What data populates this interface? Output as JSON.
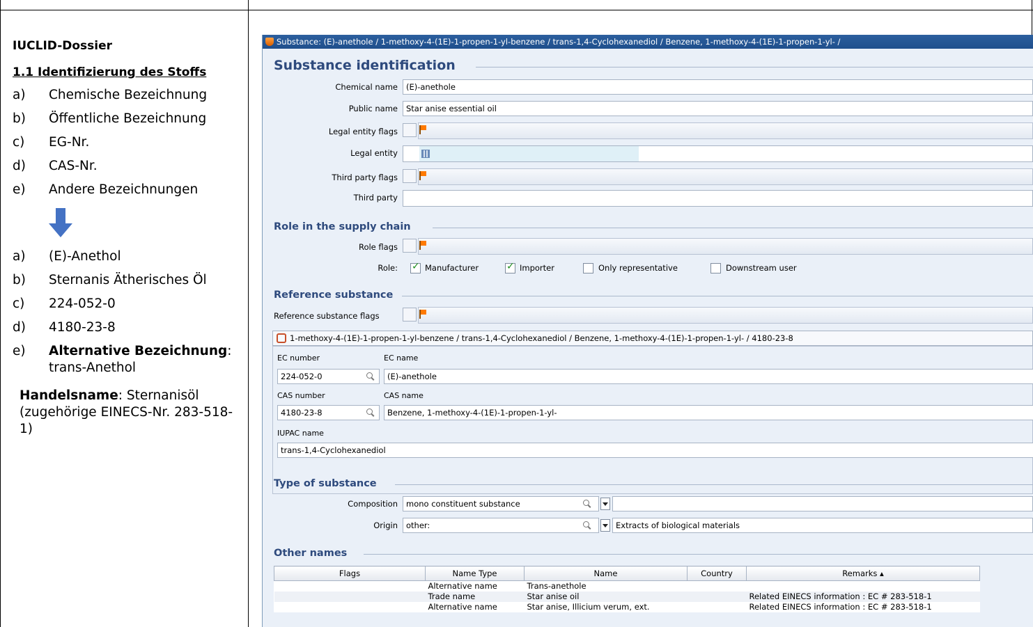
{
  "left_column": {
    "heading": "IUCLID-Dossier",
    "subheading": "1.1 Identifizierung des Stoffs",
    "criteria": [
      {
        "label": "a)",
        "text": "Chemische Bezeichnung"
      },
      {
        "label": "b)",
        "text": "Öffentliche Bezeichnung"
      },
      {
        "label": "c)",
        "text": "EG-Nr."
      },
      {
        "label": "d)",
        "text": "CAS-Nr."
      },
      {
        "label": "e)",
        "text": "Andere Bezeichnungen"
      }
    ],
    "answers": [
      {
        "label": "a)",
        "text": "(E)-Anethol"
      },
      {
        "label": "b)",
        "text": "Sternanis Ätherisches Öl"
      },
      {
        "label": "c)",
        "text": "224-052-0"
      },
      {
        "label": "d)",
        "text": "4180-23-8"
      }
    ],
    "answer_e": {
      "label": "e)",
      "bold": "Alternative Bezeichnung",
      "rest": ": trans-Anethol"
    },
    "trade": {
      "bold": "Handelsname",
      "rest": ": Sternanisöl (zugehörige EINECS-Nr. 283-518-1)"
    }
  },
  "app": {
    "window_title": "Substance: (E)-anethole / 1-methoxy-4-(1E)-1-propen-1-yl-benzene / trans-1,4-Cyclohexanediol / Benzene, 1-methoxy-4-(1E)-1-propen-1-yl- /",
    "substance_identification": {
      "title": "Substance identification",
      "chemical_name_label": "Chemical name",
      "chemical_name": "(E)-anethole",
      "public_name_label": "Public name",
      "public_name": "Star anise essential oil",
      "legal_entity_flags_label": "Legal entity flags",
      "legal_entity_label": "Legal entity",
      "third_party_flags_label": "Third party flags",
      "third_party_label": "Third party",
      "third_party": ""
    },
    "role": {
      "title": "Role in the supply chain",
      "role_flags_label": "Role flags",
      "role_label": "Role:",
      "options": [
        {
          "label": "Manufacturer",
          "checked": true
        },
        {
          "label": "Importer",
          "checked": true
        },
        {
          "label": "Only representative",
          "checked": false
        },
        {
          "label": "Downstream user",
          "checked": false
        }
      ]
    },
    "reference": {
      "title": "Reference substance",
      "flags_label": "Reference substance flags",
      "link_text": "1-methoxy-4-(1E)-1-propen-1-yl-benzene / trans-1,4-Cyclohexanediol / Benzene, 1-methoxy-4-(1E)-1-propen-1-yl- / 4180-23-8",
      "ec_number_label": "EC number",
      "ec_number": "224-052-0",
      "ec_name_label": "EC name",
      "ec_name": "(E)-anethole",
      "cas_number_label": "CAS number",
      "cas_number": "4180-23-8",
      "cas_name_label": "CAS name",
      "cas_name": "Benzene, 1-methoxy-4-(1E)-1-propen-1-yl-",
      "iupac_label": "IUPAC name",
      "iupac_name": "trans-1,4-Cyclohexanediol"
    },
    "type": {
      "title": "Type of substance",
      "composition_label": "Composition",
      "composition": "mono constituent substance",
      "composition_extra": "",
      "origin_label": "Origin",
      "origin": "other:",
      "origin_extra": "Extracts of biological materials"
    },
    "other_names": {
      "title": "Other names",
      "columns": [
        "Flags",
        "Name Type",
        "Name",
        "Country",
        "Remarks ▴"
      ],
      "rows": [
        {
          "flags": "",
          "type": "Alternative name",
          "name": "Trans-anethole",
          "country": "",
          "remarks": ""
        },
        {
          "flags": "",
          "type": "Trade name",
          "name": "Star anise oil",
          "country": "",
          "remarks": "Related EINECS information : EC # 283-518-1"
        },
        {
          "flags": "",
          "type": "Alternative name",
          "name": "Star anise, Illicium verum, ext.",
          "country": "",
          "remarks": "Related EINECS information : EC # 283-518-1"
        }
      ]
    }
  }
}
